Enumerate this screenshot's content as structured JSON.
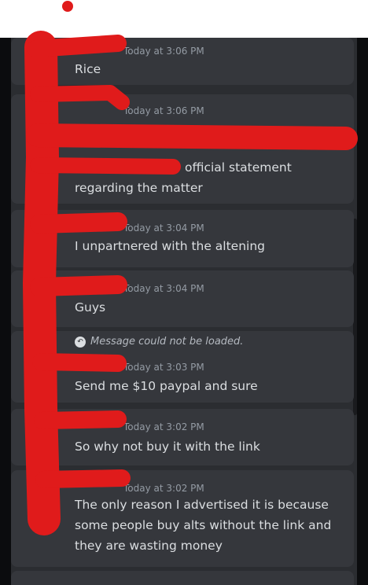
{
  "messages": [
    {
      "timestamp": "Today at 3:06 PM",
      "lines": [
        "Rice"
      ]
    },
    {
      "timestamp": "Today at 3:06 PM",
      "lines": [
        "official statement",
        "regarding the matter"
      ]
    },
    {
      "timestamp": "Today at 3:04 PM",
      "lines": [
        "I unpartnered with the altening"
      ]
    },
    {
      "timestamp": "Today at 3:04 PM",
      "lines": [
        "Guys"
      ]
    },
    {
      "reply": "Message could not be loaded.",
      "timestamp": "Today at 3:03 PM",
      "lines": [
        "Send me $10 paypal and sure"
      ]
    },
    {
      "timestamp": "Today at 3:02 PM",
      "lines": [
        "So why not buy it with the link"
      ]
    },
    {
      "timestamp": "Today at 3:02 PM",
      "lines": [
        "The only reason I advertised it is because",
        "some people buy alts without the link and",
        "they are wasting money"
      ]
    }
  ],
  "colors": {
    "scribble": "#e01b1b",
    "panel": "#2b2d31",
    "message_bg": "#35373c",
    "text": "#dbdee1",
    "timestamp": "#949ba4"
  }
}
